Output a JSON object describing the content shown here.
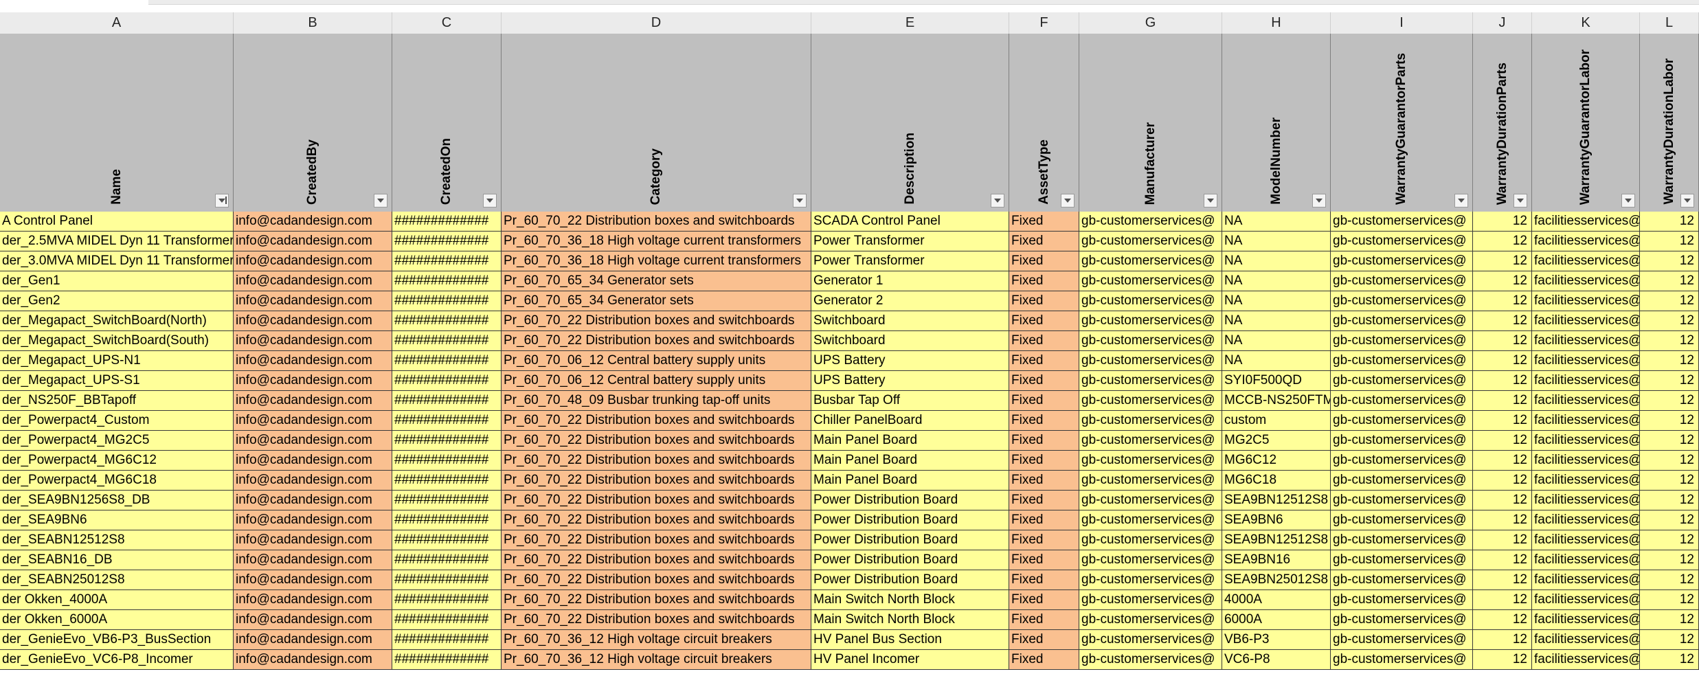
{
  "columns": [
    {
      "letter": "A",
      "header": "Name"
    },
    {
      "letter": "B",
      "header": "CreatedBy"
    },
    {
      "letter": "C",
      "header": "CreatedOn"
    },
    {
      "letter": "D",
      "header": "Category"
    },
    {
      "letter": "E",
      "header": "Description"
    },
    {
      "letter": "F",
      "header": "AssetType"
    },
    {
      "letter": "G",
      "header": "Manufacturer"
    },
    {
      "letter": "H",
      "header": "ModelNumber"
    },
    {
      "letter": "I",
      "header": "WarrantyGuarantorParts"
    },
    {
      "letter": "J",
      "header": "WarrantyDurationParts"
    },
    {
      "letter": "K",
      "header": "WarrantyGuarantorLabor"
    },
    {
      "letter": "L",
      "header": "WarrantyDurationLabor"
    }
  ],
  "rows": [
    {
      "name": "A Control Panel",
      "createdBy": "info@cadandesign.com",
      "createdOn": "#############",
      "category": "Pr_60_70_22 Distribution boxes and switchboards",
      "description": "SCADA Control Panel",
      "assetType": "Fixed",
      "manufacturer": "gb-customerservices@",
      "model": "NA",
      "guarantorParts": "gb-customerservices@",
      "durationParts": "12",
      "guarantorLabor": "facilitiesservices@",
      "durationLabor": "12"
    },
    {
      "name": "der_2.5MVA MIDEL Dyn 11 Transformer",
      "createdBy": "info@cadandesign.com",
      "createdOn": "#############",
      "category": "Pr_60_70_36_18 High voltage current transformers",
      "description": "Power Transformer",
      "assetType": "Fixed",
      "manufacturer": "gb-customerservices@",
      "model": "NA",
      "guarantorParts": "gb-customerservices@",
      "durationParts": "12",
      "guarantorLabor": "facilitiesservices@",
      "durationLabor": "12"
    },
    {
      "name": "der_3.0MVA MIDEL Dyn 11 Transformer",
      "createdBy": "info@cadandesign.com",
      "createdOn": "#############",
      "category": "Pr_60_70_36_18 High voltage current transformers",
      "description": "Power Transformer",
      "assetType": "Fixed",
      "manufacturer": "gb-customerservices@",
      "model": "NA",
      "guarantorParts": "gb-customerservices@",
      "durationParts": "12",
      "guarantorLabor": "facilitiesservices@",
      "durationLabor": "12"
    },
    {
      "name": "der_Gen1",
      "createdBy": "info@cadandesign.com",
      "createdOn": "#############",
      "category": "Pr_60_70_65_34 Generator sets",
      "description": "Generator 1",
      "assetType": "Fixed",
      "manufacturer": "gb-customerservices@",
      "model": "NA",
      "guarantorParts": "gb-customerservices@",
      "durationParts": "12",
      "guarantorLabor": "facilitiesservices@",
      "durationLabor": "12"
    },
    {
      "name": "der_Gen2",
      "createdBy": "info@cadandesign.com",
      "createdOn": "#############",
      "category": "Pr_60_70_65_34 Generator sets",
      "description": "Generator 2",
      "assetType": "Fixed",
      "manufacturer": "gb-customerservices@",
      "model": "NA",
      "guarantorParts": "gb-customerservices@",
      "durationParts": "12",
      "guarantorLabor": "facilitiesservices@",
      "durationLabor": "12"
    },
    {
      "name": "der_Megapact_SwitchBoard(North)",
      "createdBy": "info@cadandesign.com",
      "createdOn": "#############",
      "category": "Pr_60_70_22 Distribution boxes and switchboards",
      "description": "Switchboard",
      "assetType": "Fixed",
      "manufacturer": "gb-customerservices@",
      "model": "NA",
      "guarantorParts": "gb-customerservices@",
      "durationParts": "12",
      "guarantorLabor": "facilitiesservices@",
      "durationLabor": "12"
    },
    {
      "name": "der_Megapact_SwitchBoard(South)",
      "createdBy": "info@cadandesign.com",
      "createdOn": "#############",
      "category": "Pr_60_70_22 Distribution boxes and switchboards",
      "description": "Switchboard",
      "assetType": "Fixed",
      "manufacturer": "gb-customerservices@",
      "model": "NA",
      "guarantorParts": "gb-customerservices@",
      "durationParts": "12",
      "guarantorLabor": "facilitiesservices@",
      "durationLabor": "12"
    },
    {
      "name": "der_Megapact_UPS-N1",
      "createdBy": "info@cadandesign.com",
      "createdOn": "#############",
      "category": "Pr_60_70_06_12 Central battery supply units",
      "description": "UPS Battery",
      "assetType": "Fixed",
      "manufacturer": "gb-customerservices@",
      "model": "NA",
      "guarantorParts": "gb-customerservices@",
      "durationParts": "12",
      "guarantorLabor": "facilitiesservices@",
      "durationLabor": "12"
    },
    {
      "name": "der_Megapact_UPS-S1",
      "createdBy": "info@cadandesign.com",
      "createdOn": "#############",
      "category": "Pr_60_70_06_12 Central battery supply units",
      "description": "UPS Battery",
      "assetType": "Fixed",
      "manufacturer": "gb-customerservices@",
      "model": "SYI0F500QD",
      "guarantorParts": "gb-customerservices@",
      "durationParts": "12",
      "guarantorLabor": "facilitiesservices@",
      "durationLabor": "12"
    },
    {
      "name": "der_NS250F_BBTapoff",
      "createdBy": "info@cadandesign.com",
      "createdOn": "#############",
      "category": "Pr_60_70_48_09 Busbar trunking tap-off units",
      "description": "Busbar Tap Off",
      "assetType": "Fixed",
      "manufacturer": "gb-customerservices@",
      "model": "MCCB-NS250FTM",
      "guarantorParts": "gb-customerservices@",
      "durationParts": "12",
      "guarantorLabor": "facilitiesservices@",
      "durationLabor": "12"
    },
    {
      "name": "der_Powerpact4_Custom",
      "createdBy": "info@cadandesign.com",
      "createdOn": "#############",
      "category": "Pr_60_70_22 Distribution boxes and switchboards",
      "description": "Chiller PanelBoard",
      "assetType": "Fixed",
      "manufacturer": "gb-customerservices@",
      "model": "custom",
      "guarantorParts": "gb-customerservices@",
      "durationParts": "12",
      "guarantorLabor": "facilitiesservices@",
      "durationLabor": "12"
    },
    {
      "name": "der_Powerpact4_MG2C5",
      "createdBy": "info@cadandesign.com",
      "createdOn": "#############",
      "category": "Pr_60_70_22 Distribution boxes and switchboards",
      "description": "Main Panel Board",
      "assetType": "Fixed",
      "manufacturer": "gb-customerservices@",
      "model": "MG2C5",
      "guarantorParts": "gb-customerservices@",
      "durationParts": "12",
      "guarantorLabor": "facilitiesservices@",
      "durationLabor": "12"
    },
    {
      "name": "der_Powerpact4_MG6C12",
      "createdBy": "info@cadandesign.com",
      "createdOn": "#############",
      "category": "Pr_60_70_22 Distribution boxes and switchboards",
      "description": "Main Panel Board",
      "assetType": "Fixed",
      "manufacturer": "gb-customerservices@",
      "model": "MG6C12",
      "guarantorParts": "gb-customerservices@",
      "durationParts": "12",
      "guarantorLabor": "facilitiesservices@",
      "durationLabor": "12"
    },
    {
      "name": "der_Powerpact4_MG6C18",
      "createdBy": "info@cadandesign.com",
      "createdOn": "#############",
      "category": "Pr_60_70_22 Distribution boxes and switchboards",
      "description": "Main Panel Board",
      "assetType": "Fixed",
      "manufacturer": "gb-customerservices@",
      "model": "MG6C18",
      "guarantorParts": "gb-customerservices@",
      "durationParts": "12",
      "guarantorLabor": "facilitiesservices@",
      "durationLabor": "12"
    },
    {
      "name": "der_SEA9BN1256S8_DB",
      "createdBy": "info@cadandesign.com",
      "createdOn": "#############",
      "category": "Pr_60_70_22 Distribution boxes and switchboards",
      "description": "Power Distribution Board",
      "assetType": "Fixed",
      "manufacturer": "gb-customerservices@",
      "model": "SEA9BN12512S8",
      "guarantorParts": "gb-customerservices@",
      "durationParts": "12",
      "guarantorLabor": "facilitiesservices@",
      "durationLabor": "12"
    },
    {
      "name": "der_SEA9BN6",
      "createdBy": "info@cadandesign.com",
      "createdOn": "#############",
      "category": "Pr_60_70_22 Distribution boxes and switchboards",
      "description": "Power Distribution Board",
      "assetType": "Fixed",
      "manufacturer": "gb-customerservices@",
      "model": "SEA9BN6",
      "guarantorParts": "gb-customerservices@",
      "durationParts": "12",
      "guarantorLabor": "facilitiesservices@",
      "durationLabor": "12"
    },
    {
      "name": "der_SEABN12512S8",
      "createdBy": "info@cadandesign.com",
      "createdOn": "#############",
      "category": "Pr_60_70_22 Distribution boxes and switchboards",
      "description": "Power Distribution Board",
      "assetType": "Fixed",
      "manufacturer": "gb-customerservices@",
      "model": "SEA9BN12512S8",
      "guarantorParts": "gb-customerservices@",
      "durationParts": "12",
      "guarantorLabor": "facilitiesservices@",
      "durationLabor": "12"
    },
    {
      "name": "der_SEABN16_DB",
      "createdBy": "info@cadandesign.com",
      "createdOn": "#############",
      "category": "Pr_60_70_22 Distribution boxes and switchboards",
      "description": "Power Distribution Board",
      "assetType": "Fixed",
      "manufacturer": "gb-customerservices@",
      "model": "SEA9BN16",
      "guarantorParts": "gb-customerservices@",
      "durationParts": "12",
      "guarantorLabor": "facilitiesservices@",
      "durationLabor": "12"
    },
    {
      "name": "der_SEABN25012S8",
      "createdBy": "info@cadandesign.com",
      "createdOn": "#############",
      "category": "Pr_60_70_22 Distribution boxes and switchboards",
      "description": "Power Distribution Board",
      "assetType": "Fixed",
      "manufacturer": "gb-customerservices@",
      "model": "SEA9BN25012S8",
      "guarantorParts": "gb-customerservices@",
      "durationParts": "12",
      "guarantorLabor": "facilitiesservices@",
      "durationLabor": "12"
    },
    {
      "name": "der Okken_4000A",
      "createdBy": "info@cadandesign.com",
      "createdOn": "#############",
      "category": "Pr_60_70_22 Distribution boxes and switchboards",
      "description": "Main Switch North Block",
      "assetType": "Fixed",
      "manufacturer": "gb-customerservices@",
      "model": "4000A",
      "guarantorParts": "gb-customerservices@",
      "durationParts": "12",
      "guarantorLabor": "facilitiesservices@",
      "durationLabor": "12"
    },
    {
      "name": "der Okken_6000A",
      "createdBy": "info@cadandesign.com",
      "createdOn": "#############",
      "category": "Pr_60_70_22 Distribution boxes and switchboards",
      "description": "Main Switch North Block",
      "assetType": "Fixed",
      "manufacturer": "gb-customerservices@",
      "model": "6000A",
      "guarantorParts": "gb-customerservices@",
      "durationParts": "12",
      "guarantorLabor": "facilitiesservices@",
      "durationLabor": "12"
    },
    {
      "name": "der_GenieEvo_VB6-P3_BusSection",
      "createdBy": "info@cadandesign.com",
      "createdOn": "#############",
      "category": "Pr_60_70_36_12 High voltage circuit breakers",
      "description": "HV Panel Bus Section",
      "assetType": "Fixed",
      "manufacturer": "gb-customerservices@",
      "model": "VB6-P3",
      "guarantorParts": "gb-customerservices@",
      "durationParts": "12",
      "guarantorLabor": "facilitiesservices@",
      "durationLabor": "12"
    },
    {
      "name": "der_GenieEvo_VC6-P8_Incomer",
      "createdBy": "info@cadandesign.com",
      "createdOn": "#############",
      "category": "Pr_60_70_36_12 High voltage circuit breakers",
      "description": "HV Panel Incomer",
      "assetType": "Fixed",
      "manufacturer": "gb-customerservices@",
      "model": "VC6-P8",
      "guarantorParts": "gb-customerservices@",
      "durationParts": "12",
      "guarantorLabor": "facilitiesservices@",
      "durationLabor": "12"
    }
  ]
}
